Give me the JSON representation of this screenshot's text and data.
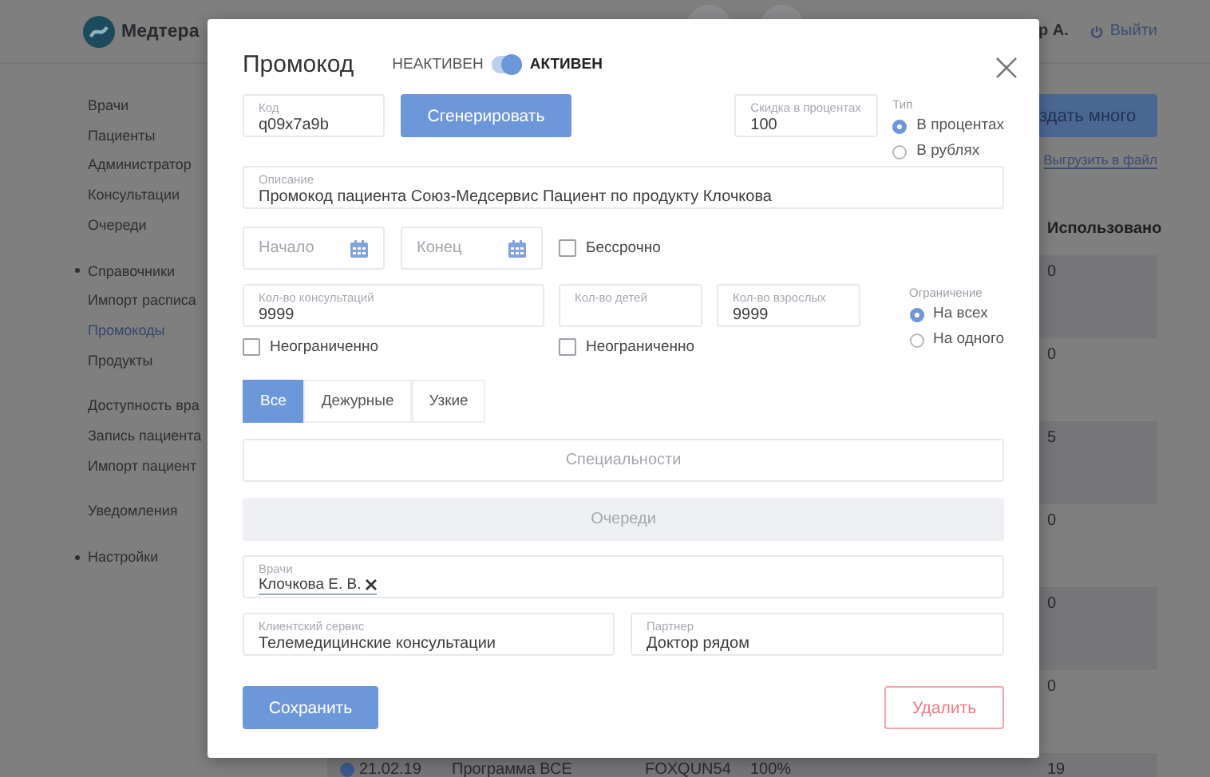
{
  "header": {
    "logo": "Медтера",
    "user": "р А.",
    "logout": "Выйти"
  },
  "sidebar": {
    "groups": [
      {
        "items": [
          {
            "label": "Врачи",
            "kind": "link",
            "selected": false
          },
          {
            "label": "Пациенты",
            "kind": "link",
            "selected": false
          },
          {
            "label": "Администратор",
            "kind": "link",
            "selected": false
          },
          {
            "label": "Консультации",
            "kind": "link",
            "selected": false
          },
          {
            "label": "Очереди",
            "kind": "link",
            "selected": false
          }
        ]
      },
      {
        "items": [
          {
            "label": "Справочники",
            "kind": "section",
            "selected": false
          },
          {
            "label": "Импорт расписа",
            "kind": "link",
            "selected": false
          },
          {
            "label": "Промокоды",
            "kind": "link",
            "selected": true
          },
          {
            "label": "Продукты",
            "kind": "link",
            "selected": false
          }
        ]
      },
      {
        "items": [
          {
            "label": "Доступность вра",
            "kind": "link",
            "selected": false
          },
          {
            "label": "Запись пациента",
            "kind": "link",
            "selected": false
          },
          {
            "label": "Импорт пациент",
            "kind": "link",
            "selected": false
          }
        ]
      },
      {
        "items": [
          {
            "label": "Уведомления",
            "kind": "link",
            "selected": false
          }
        ]
      },
      {
        "items": [
          {
            "label": "Настройки",
            "kind": "section",
            "selected": false
          }
        ]
      }
    ]
  },
  "toolbar": {
    "create_button": "здать много",
    "export_link": "Выгрузить в файл"
  },
  "table": {
    "columns": [
      "Использовано"
    ],
    "rows": [
      {
        "used": "0"
      },
      {
        "used": "0"
      },
      {
        "used": "5"
      },
      {
        "used": "0"
      },
      {
        "used": "0"
      },
      {
        "used": "0"
      },
      {
        "checked": true,
        "date": "21.02.19",
        "program": "Программа ВСЕ",
        "code": "FOXQUN54",
        "discount": "100%",
        "used": "19"
      }
    ]
  },
  "dialog": {
    "title": "Промокод",
    "status": {
      "inactive_label": "НЕАКТИВЕН",
      "active_label": "АКТИВЕН",
      "on": true
    },
    "code": {
      "label": "Код",
      "value": "q09x7a9b"
    },
    "generate_button": "Сгенерировать",
    "discount": {
      "label": "Скидка в процентах",
      "value": "100"
    },
    "type": {
      "label": "Тип",
      "options": [
        {
          "label": "В процентах",
          "selected": true
        },
        {
          "label": "В рублях",
          "selected": false
        }
      ]
    },
    "description": {
      "label": "Описание",
      "value": "Промокод пациента Союз-Медсервис Пациент по продукту Клочкова"
    },
    "start": {
      "placeholder": "Начало"
    },
    "end": {
      "placeholder": "Конец"
    },
    "no_end": {
      "label": "Бессрочно",
      "checked": false
    },
    "counts": [
      {
        "label": "Кол-во консультаций",
        "value": "9999"
      },
      {
        "label": "Кол-во детей"
      },
      {
        "label": "Кол-во взрослых",
        "value": "9999"
      }
    ],
    "unlimited": [
      {
        "label": "Неограниченно",
        "checked": false
      },
      {
        "label": "Неограниченно",
        "checked": false
      }
    ],
    "limit": {
      "label": "Ограничение",
      "options": [
        {
          "label": "На всех",
          "selected": true
        },
        {
          "label": "На одного",
          "selected": false
        }
      ]
    },
    "tabs": [
      {
        "label": "Все",
        "selected": true
      },
      {
        "label": "Дежурные",
        "selected": false
      },
      {
        "label": "Узкие",
        "selected": false
      }
    ],
    "specialties": {
      "placeholder": "Специальности"
    },
    "queues": {
      "placeholder": "Очереди",
      "disabled": true
    },
    "doctors": {
      "label": "Врачи",
      "chips": [
        "Клочкова Е. В."
      ]
    },
    "client_service": {
      "label": "Клиентский сервис",
      "value": "Телемедицинские консультации"
    },
    "partner": {
      "label": "Партнер",
      "value": "Доктор рядом"
    },
    "save_button": "Сохранить",
    "delete_button": "Удалить"
  }
}
